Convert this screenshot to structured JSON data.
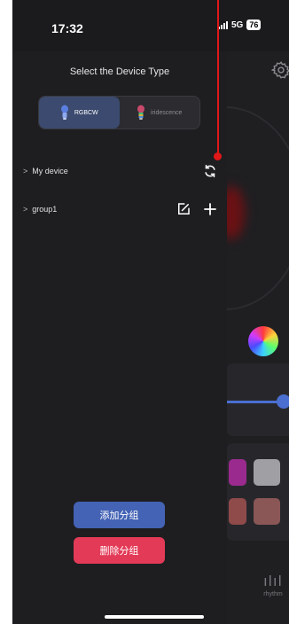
{
  "status_bar": {
    "time": "17:32",
    "network": "5G",
    "battery": "76"
  },
  "drawer": {
    "title": "Select the Device Type",
    "device_types": [
      {
        "label": "RGBCW",
        "active": true
      },
      {
        "label": "iridescence",
        "active": false
      }
    ],
    "groups": [
      {
        "label": "My device",
        "action_icon": "refresh-icon"
      },
      {
        "label": "group1",
        "action_icons": [
          "edit-icon",
          "plus-icon"
        ]
      }
    ],
    "add_group_label": "添加分组",
    "delete_group_label": "删除分组"
  },
  "background": {
    "tab_rhythm_label": "rhythm"
  },
  "colors": {
    "accent_blue": "#4463b5",
    "delete_red": "#e33b57",
    "annotation_red": "#e01818",
    "drawer_bg": "#1e1e21"
  }
}
